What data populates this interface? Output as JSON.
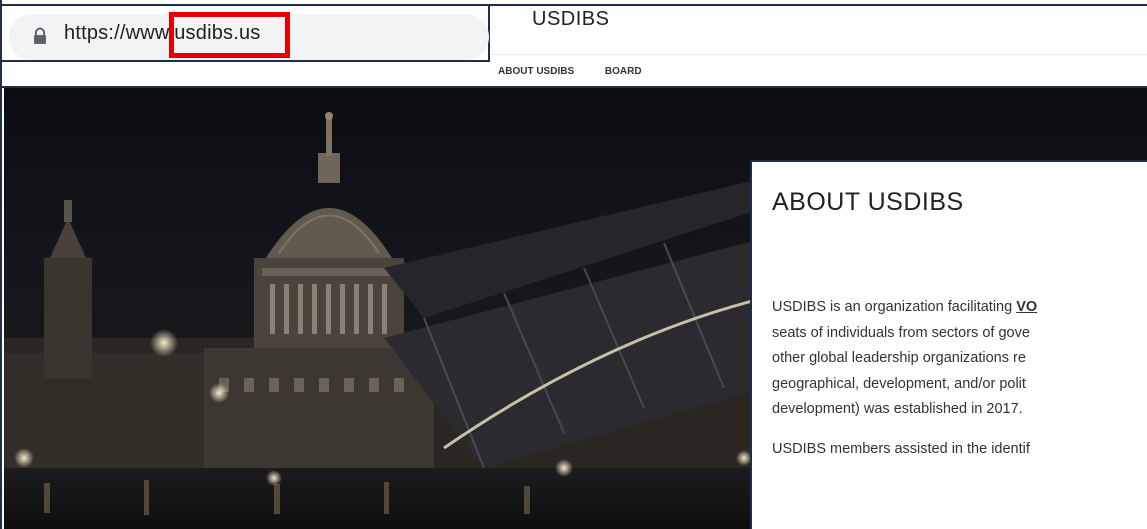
{
  "browser": {
    "url": "https://www.usdibs.us",
    "url_prefix": "https://ww",
    "url_highlighted": "w.usdibs.us"
  },
  "site": {
    "title": "USDIBS",
    "nav": [
      "ABOUT USDIBS",
      "BOARD"
    ]
  },
  "about": {
    "heading": "ABOUT USDIBS",
    "p1_lines": [
      "USDIBS is an organization facilitating ",
      "seats of individuals from sectors of gove",
      "other global leadership organizations re",
      "geographical, development, and/or polit",
      "development) was established in 2017."
    ],
    "p1_emph": "VO",
    "p2_line": "USDIBS members assisted in the identif"
  },
  "colors": {
    "highlight": "#e60000",
    "border": "#1f2f4a"
  }
}
